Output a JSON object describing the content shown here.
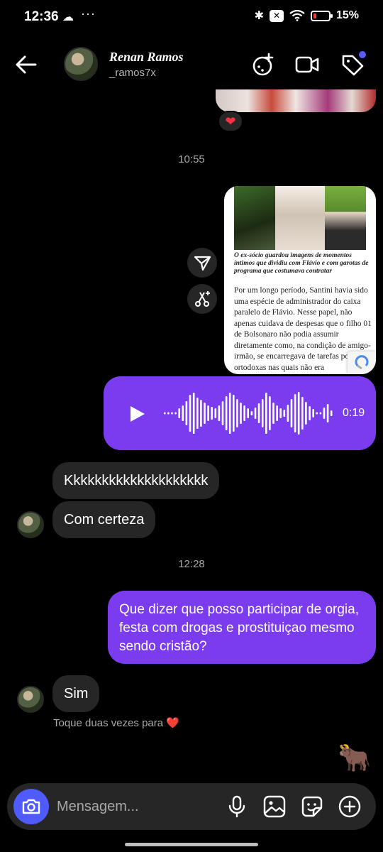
{
  "status": {
    "time": "12:36",
    "battery": "15%"
  },
  "header": {
    "name": "Renan Ramos",
    "handle": "_ramos7x"
  },
  "thread": {
    "time_1": "10:55",
    "shared_post": {
      "caption": "O ex-sócio guardou imagens de momentos íntimos que dividiu com Flávio e com garotas de programa que costumava contratar",
      "body": "Por um longo período, Santini havia sido uma espécie de administrador do caixa paralelo de Flávio. Nesse papel, não apenas cuidava de despesas que o filho 01 de Bolsonaro não podia assumir diretamente como, na condição de amigo-irmão, se encarregava de tarefas pouco ortodoxas nas quais não era"
    },
    "voice": {
      "duration": "0:19"
    },
    "in_1": "Kkkkkkkkkkkkkkkkkkkk",
    "in_2": "Com certeza",
    "time_2": "12:28",
    "out_1": "Que dizer que posso participar de orgia, festa com drogas e prostituiçao mesmo sendo cristão?",
    "in_3": "Sim",
    "hint": "Toque duas vezes para ❤️",
    "sticker": "🐂"
  },
  "composer": {
    "placeholder": "Mensagem..."
  },
  "colors": {
    "accent": "#7b3cf0",
    "camera": "#4f5bff",
    "bubble_in": "#262626",
    "heart": "#ff3040"
  }
}
